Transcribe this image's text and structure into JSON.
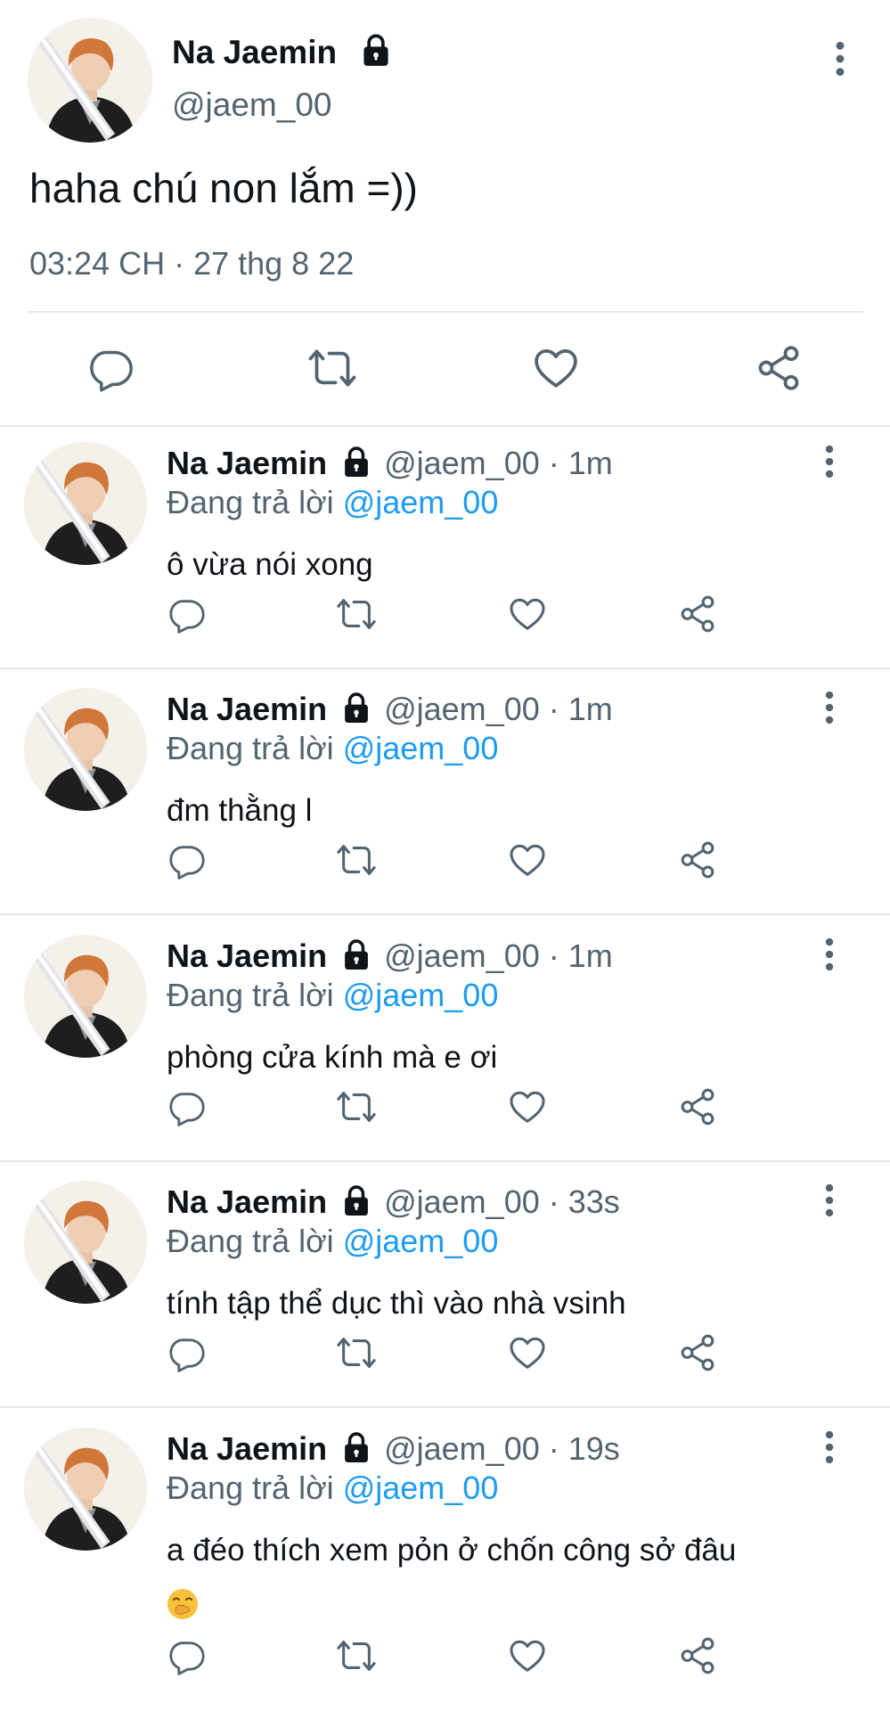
{
  "main_tweet": {
    "display_name": "Na Jaemin",
    "handle": "@jaem_00",
    "text": "haha chú non lắm =))",
    "timestamp": "03:24 CH · 27 thg 8 22",
    "protected_icon": "lock-icon",
    "more_icon": "more-vertical-icon",
    "actions": [
      "reply-icon",
      "retweet-icon",
      "like-icon",
      "share-icon"
    ]
  },
  "replies": [
    {
      "display_name": "Na Jaemin",
      "handle_time": "@jaem_00 · 1m",
      "replying_label": "Đang trả lời",
      "replying_to": "@jaem_00",
      "text": "ô vừa nói xong"
    },
    {
      "display_name": "Na Jaemin",
      "handle_time": "@jaem_00 · 1m",
      "replying_label": "Đang trả lời",
      "replying_to": "@jaem_00",
      "text": "đm thằng l"
    },
    {
      "display_name": "Na Jaemin",
      "handle_time": "@jaem_00 · 1m",
      "replying_label": "Đang trả lời",
      "replying_to": "@jaem_00",
      "text": "phòng cửa kính mà e ơi"
    },
    {
      "display_name": "Na Jaemin",
      "handle_time": "@jaem_00 · 33s",
      "replying_label": "Đang trả lời",
      "replying_to": "@jaem_00",
      "text": "tính tập thể dục thì vào nhà vsinh"
    },
    {
      "display_name": "Na Jaemin",
      "handle_time": "@jaem_00 · 19s",
      "replying_label": "Đang trả lời",
      "replying_to": "@jaem_00",
      "text": "a đéo thích xem pỏn ở chốn công sở đâu",
      "emoji": "yawning-face-emoji"
    }
  ],
  "colors": {
    "text_primary": "#0f1419",
    "text_secondary": "#536471",
    "accent_blue": "#1d9bf0",
    "divider": "#e7e9eb",
    "icon_gray": "#536471"
  }
}
